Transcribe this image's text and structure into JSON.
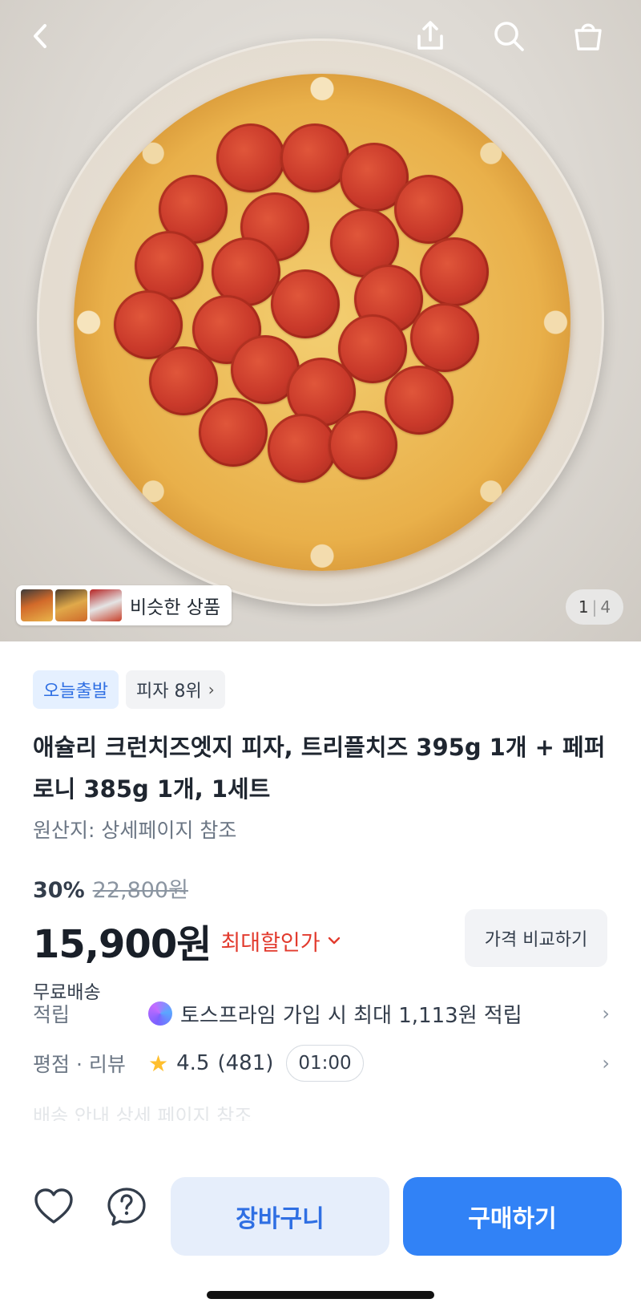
{
  "header": {
    "back_icon": "chevron-left-icon",
    "share_icon": "share-icon",
    "search_icon": "search-icon",
    "cart_icon": "shopping-bag-icon"
  },
  "gallery": {
    "similar_label": "비슷한 상품",
    "page_current": "1",
    "page_separator": "|",
    "page_total": "4"
  },
  "product": {
    "chips": [
      "오늘출발",
      "피자 8위"
    ],
    "title": "애슐리 크런치즈엣지 피자, 트리플치즈 395g 1개 + 페퍼로니 385g 1개, 1세트",
    "origin": "원산지: 상세페이지 참조",
    "discount": "30%",
    "original_price": "22,800원",
    "price": "15,900원",
    "max_discount_label": "최대할인가",
    "compare_label": "가격 비교하기",
    "shipping": "무료배송"
  },
  "info": {
    "reward_key": "적립",
    "reward_value": "토스프라임 가입 시 최대 1,113원 적립",
    "review_key": "평점 · 리뷰",
    "review_rating": "4.5",
    "review_count": "(481)",
    "timer": "01:00",
    "faded_text": "배송 안내        상세 페이지 참조"
  },
  "bottom": {
    "cart_label": "장바구니",
    "buy_label": "구매하기",
    "like_icon": "heart-icon",
    "question_icon": "question-icon"
  },
  "colors": {
    "primary": "#3182f6",
    "discount_red": "#e23b2e",
    "chip_blue": "#2f6fe3"
  }
}
